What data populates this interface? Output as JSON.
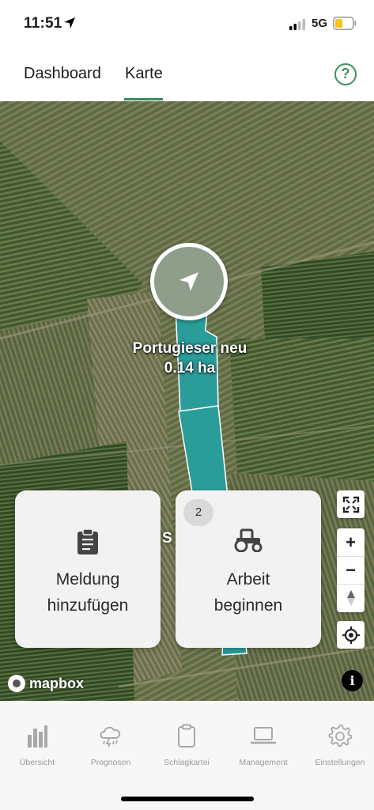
{
  "status_bar": {
    "time": "11:51",
    "network": "5G",
    "icons": [
      "location-arrow-icon",
      "signal-icon",
      "battery-icon"
    ],
    "battery_color": "#f5c518"
  },
  "tabs": {
    "items": [
      {
        "label": "Dashboard",
        "active": false
      },
      {
        "label": "Karte",
        "active": true
      }
    ],
    "help_label": "?",
    "accent_color": "#3a8a5a"
  },
  "map": {
    "field_name": "Portugieser neu",
    "field_area": "0.14 ha",
    "partial_label": "S",
    "field_color": "#2a9d9a",
    "attribution": "mapbox",
    "info_label": "i"
  },
  "cards": {
    "meldung": {
      "line1": "Meldung",
      "line2": "hinzufügen",
      "icon": "clipboard-icon"
    },
    "arbeit": {
      "line1": "Arbeit",
      "line2": "beginnen",
      "icon": "tractor-icon",
      "badge": "2"
    }
  },
  "map_controls": {
    "zoom_in": "+",
    "zoom_out": "−",
    "icons": [
      "fullscreen-icon",
      "compass-icon",
      "locate-icon"
    ]
  },
  "bottom_nav": {
    "items": [
      {
        "label": "Übersicht",
        "icon": "bar-chart-icon"
      },
      {
        "label": "Prognosen",
        "icon": "storm-cloud-icon"
      },
      {
        "label": "Schlagkartei",
        "icon": "clipboard-icon"
      },
      {
        "label": "Management",
        "icon": "laptop-icon"
      },
      {
        "label": "Einstellungen",
        "icon": "gear-icon"
      }
    ]
  }
}
